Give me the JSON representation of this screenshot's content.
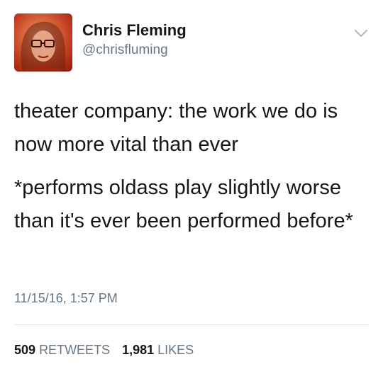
{
  "author": {
    "display_name": "Chris Fleming",
    "handle": "@chrisfluming"
  },
  "tweet": {
    "paragraphs": [
      "theater company: the work we do is now more vital than ever",
      "*performs oldass play slightly worse than it's ever been performed before*"
    ],
    "timestamp": "11/15/16, 1:57 PM"
  },
  "stats": {
    "retweets_count": "509",
    "retweets_label": "RETWEETS",
    "likes_count": "1,981",
    "likes_label": "LIKES"
  },
  "icons": {
    "menu": "chevron-down-icon",
    "avatar": "avatar-photo"
  },
  "colors": {
    "text": "#14171a",
    "secondary": "#657786",
    "divider": "#e1e8ed",
    "avatar_bg": "#c03a1f"
  }
}
